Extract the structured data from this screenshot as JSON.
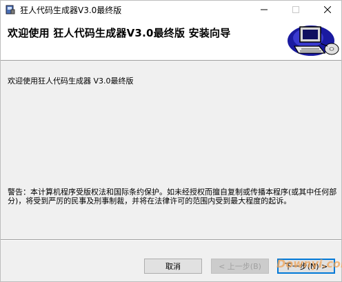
{
  "window": {
    "title": "狂人代码生成器V3.0最终版"
  },
  "banner": {
    "heading": "欢迎使用 狂人代码生成器V3.0最终版 安装向导"
  },
  "content": {
    "welcome": "欢迎使用狂人代码生成器 V3.0最终版",
    "warning": "警告：本计算机程序受版权法和国际条约保护。如未经授权而擅自复制或传播本程序(或其中任何部分)，将受到严厉的民事及刑事制裁，并将在法律许可的范围内受到最大程度的起诉。"
  },
  "buttons": {
    "cancel": "取消",
    "back": "< 上一步(B)",
    "next": "下一步(N) >"
  },
  "watermark": "Downyi.com",
  "colors": {
    "default_button_border": "#0078d7",
    "face": "#f0f0f0"
  }
}
